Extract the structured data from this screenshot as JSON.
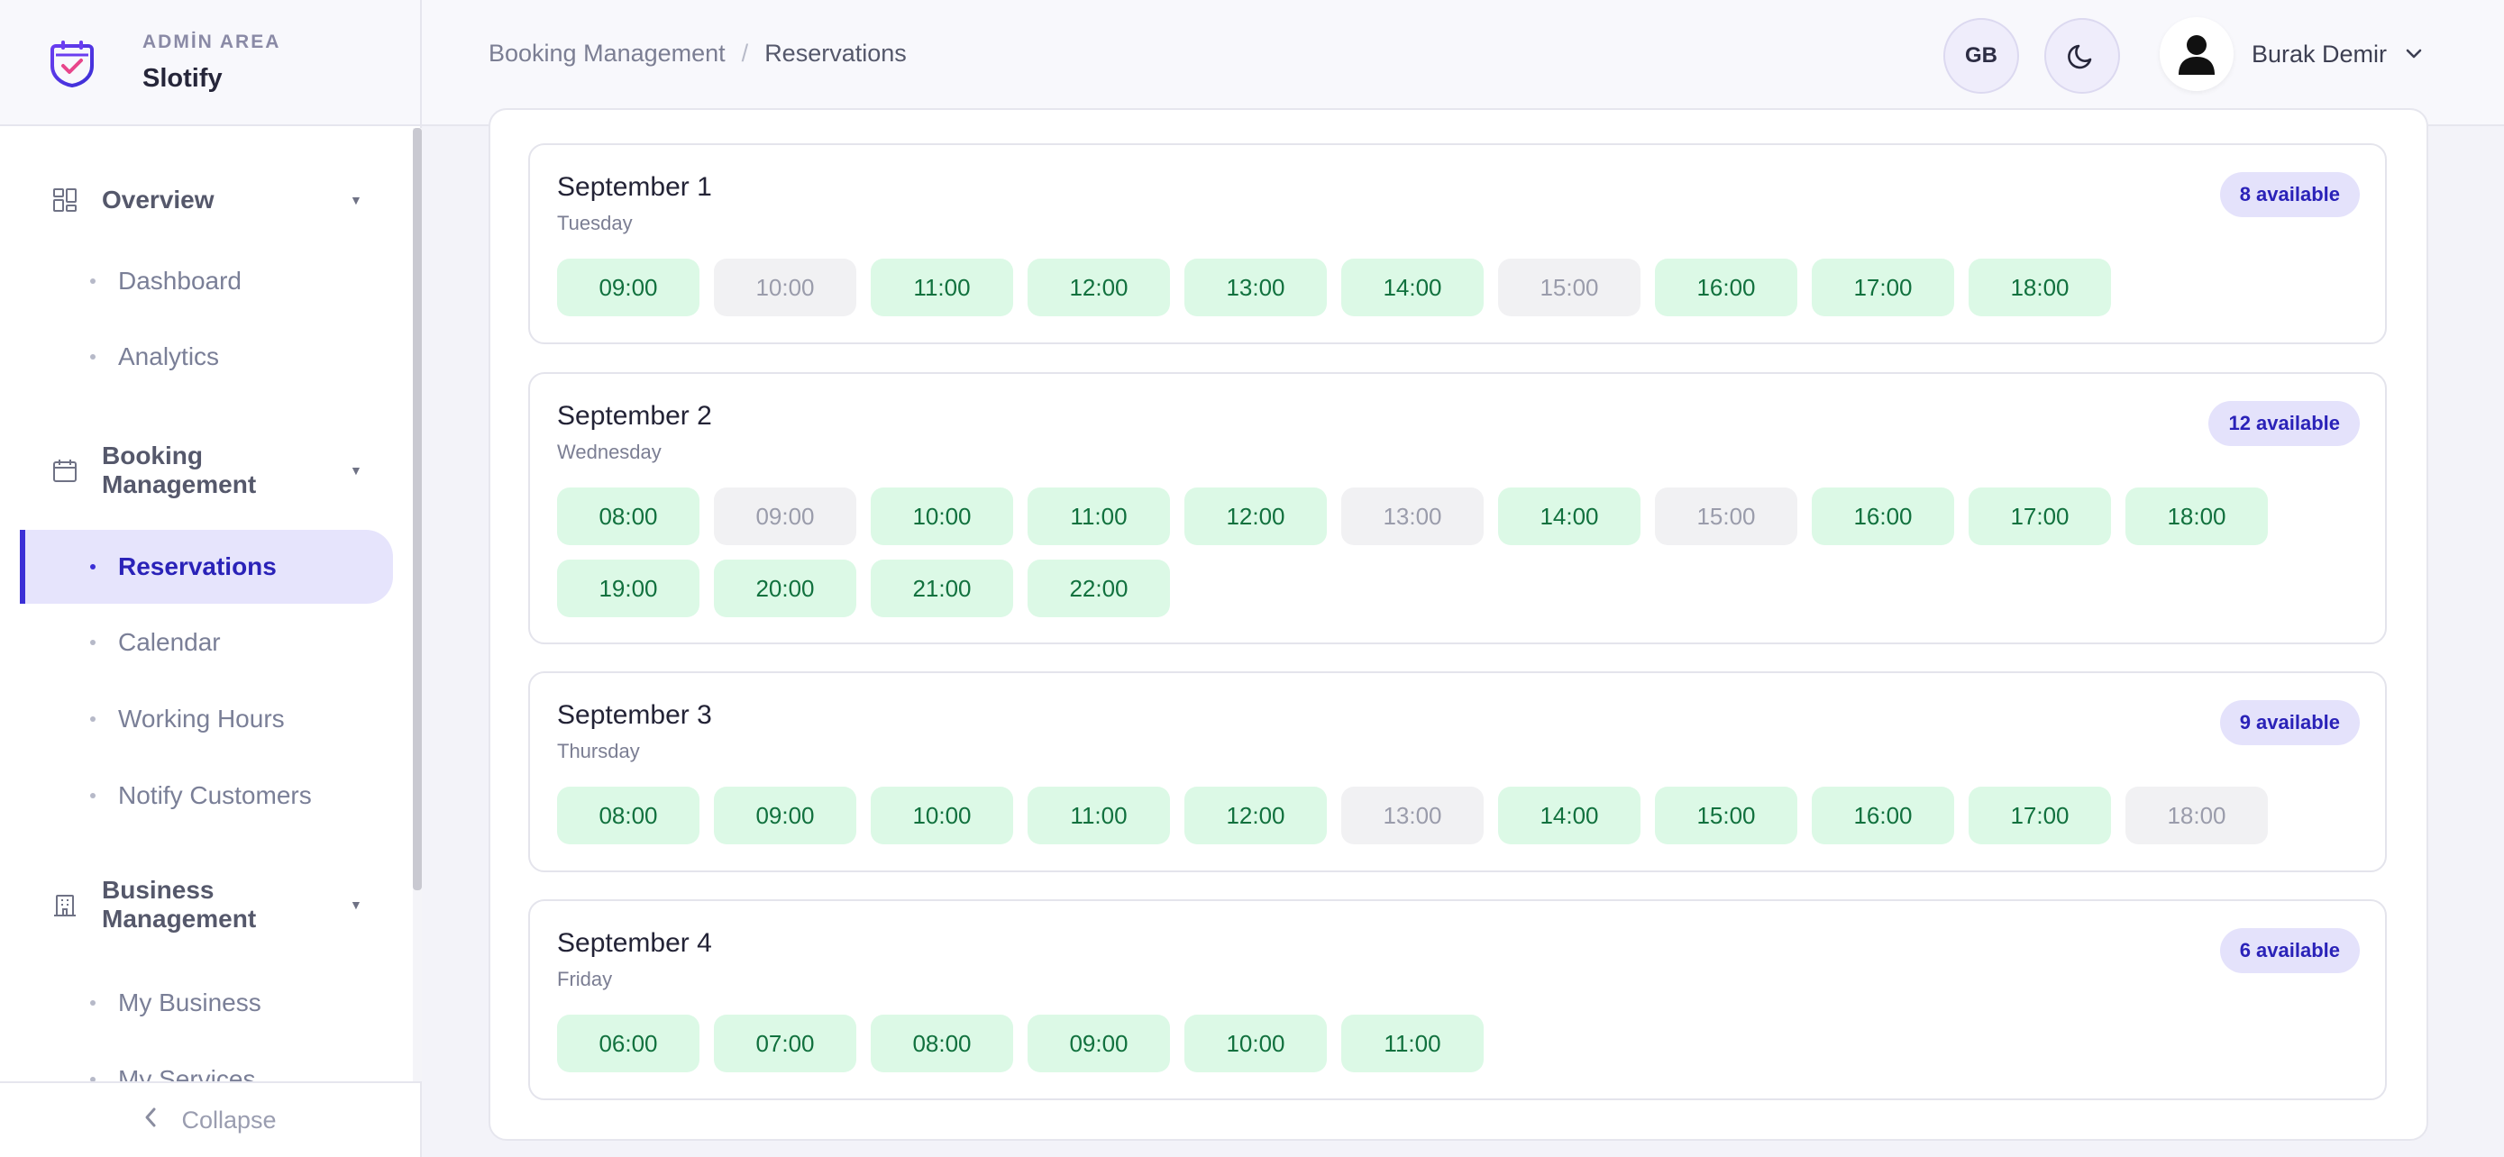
{
  "brand": {
    "area": "ADMİN AREA",
    "name": "Slotify"
  },
  "sidebar": {
    "groups": [
      {
        "label": "Overview",
        "icon": "dashboard-icon",
        "items": [
          {
            "label": "Dashboard"
          },
          {
            "label": "Analytics"
          }
        ]
      },
      {
        "label": "Booking Management",
        "icon": "calendar-icon",
        "items": [
          {
            "label": "Reservations",
            "active": true
          },
          {
            "label": "Calendar"
          },
          {
            "label": "Working Hours"
          },
          {
            "label": "Notify Customers"
          }
        ]
      },
      {
        "label": "Business Management",
        "icon": "building-icon",
        "items": [
          {
            "label": "My Business"
          },
          {
            "label": "My Services"
          }
        ]
      }
    ],
    "collapse_label": "Collapse"
  },
  "header": {
    "breadcrumb": [
      "Booking Management",
      "Reservations"
    ],
    "language": "GB",
    "theme_icon": "moon-icon",
    "user_name": "Burak Demir"
  },
  "colors": {
    "accent": "#3b2fd6",
    "available_bg": "#dcf9e6",
    "available_text": "#11713e",
    "taken_bg": "#f1f1f3",
    "taken_text": "#9a9cab",
    "badge_bg": "#e4e2fb"
  },
  "days": [
    {
      "title": "September 1",
      "weekday": "Tuesday",
      "badge": "8 available",
      "slots": [
        {
          "time": "09:00",
          "available": true
        },
        {
          "time": "10:00",
          "available": false
        },
        {
          "time": "11:00",
          "available": true
        },
        {
          "time": "12:00",
          "available": true
        },
        {
          "time": "13:00",
          "available": true
        },
        {
          "time": "14:00",
          "available": true
        },
        {
          "time": "15:00",
          "available": false
        },
        {
          "time": "16:00",
          "available": true
        },
        {
          "time": "17:00",
          "available": true
        },
        {
          "time": "18:00",
          "available": true
        }
      ]
    },
    {
      "title": "September 2",
      "weekday": "Wednesday",
      "badge": "12 available",
      "slots": [
        {
          "time": "08:00",
          "available": true
        },
        {
          "time": "09:00",
          "available": false
        },
        {
          "time": "10:00",
          "available": true
        },
        {
          "time": "11:00",
          "available": true
        },
        {
          "time": "12:00",
          "available": true
        },
        {
          "time": "13:00",
          "available": false
        },
        {
          "time": "14:00",
          "available": true
        },
        {
          "time": "15:00",
          "available": false
        },
        {
          "time": "16:00",
          "available": true
        },
        {
          "time": "17:00",
          "available": true
        },
        {
          "time": "18:00",
          "available": true
        },
        {
          "time": "19:00",
          "available": true
        },
        {
          "time": "20:00",
          "available": true
        },
        {
          "time": "21:00",
          "available": true
        },
        {
          "time": "22:00",
          "available": true
        }
      ]
    },
    {
      "title": "September 3",
      "weekday": "Thursday",
      "badge": "9 available",
      "slots": [
        {
          "time": "08:00",
          "available": true
        },
        {
          "time": "09:00",
          "available": true
        },
        {
          "time": "10:00",
          "available": true
        },
        {
          "time": "11:00",
          "available": true
        },
        {
          "time": "12:00",
          "available": true
        },
        {
          "time": "13:00",
          "available": false
        },
        {
          "time": "14:00",
          "available": true
        },
        {
          "time": "15:00",
          "available": true
        },
        {
          "time": "16:00",
          "available": true
        },
        {
          "time": "17:00",
          "available": true
        },
        {
          "time": "18:00",
          "available": false
        }
      ]
    },
    {
      "title": "September 4",
      "weekday": "Friday",
      "badge": "6 available",
      "slots": [
        {
          "time": "06:00",
          "available": true
        },
        {
          "time": "07:00",
          "available": true
        },
        {
          "time": "08:00",
          "available": true
        },
        {
          "time": "09:00",
          "available": true
        },
        {
          "time": "10:00",
          "available": true
        },
        {
          "time": "11:00",
          "available": true
        }
      ]
    }
  ]
}
